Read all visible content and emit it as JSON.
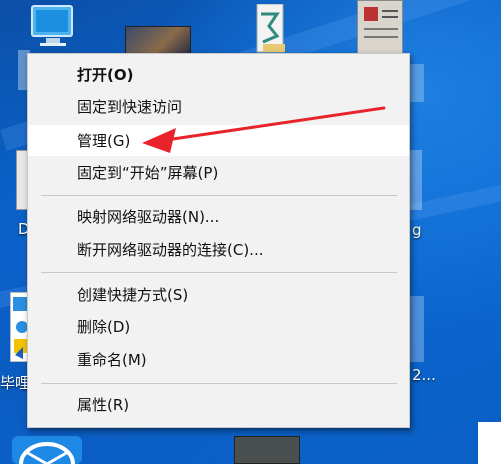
{
  "desktop": {
    "icon_labels": {
      "left_partial_1": "D",
      "left_partial_2": "毕哩",
      "right_partial_1": "g",
      "right_partial_2": "2..."
    }
  },
  "context_menu": {
    "items": [
      {
        "label": "打开(O)",
        "bold": true
      },
      {
        "label": "固定到快速访问"
      },
      {
        "label": "管理(G)",
        "highlighted": true
      },
      {
        "label": "固定到“开始”屏幕(P)"
      },
      {
        "label": "映射网络驱动器(N)..."
      },
      {
        "label": "断开网络驱动器的连接(C)..."
      },
      {
        "label": "创建快捷方式(S)"
      },
      {
        "label": "删除(D)"
      },
      {
        "label": "重命名(M)"
      },
      {
        "label": "属性(R)"
      }
    ]
  },
  "annotation": {
    "arrow_color": "#e8232b",
    "points_to": "管理(G)"
  },
  "colors": {
    "desktop_blue": "#0a63c9",
    "menu_bg": "#f2f2f2",
    "menu_highlight": "#ffffff"
  }
}
